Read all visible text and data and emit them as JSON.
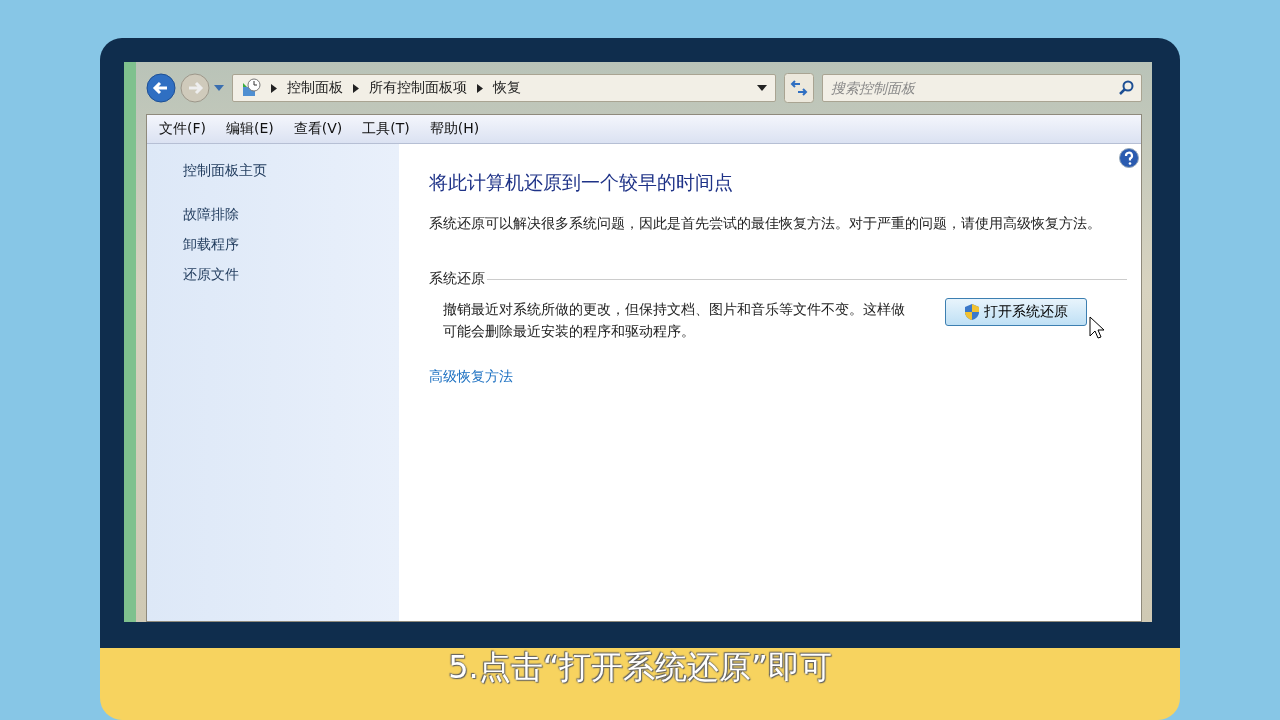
{
  "window": {
    "breadcrumb": [
      "控制面板",
      "所有控制面板项",
      "恢复"
    ],
    "search": {
      "placeholder": "搜索控制面板"
    }
  },
  "menu": [
    "文件(F)",
    "编辑(E)",
    "查看(V)",
    "工具(T)",
    "帮助(H)"
  ],
  "sidebar": {
    "items": [
      {
        "label": "控制面板主页",
        "kind": "home"
      },
      {
        "label": "故障排除",
        "kind": "link"
      },
      {
        "label": "卸载程序",
        "kind": "link"
      },
      {
        "label": "还原文件",
        "kind": "link"
      }
    ]
  },
  "content": {
    "title": "将此计算机还原到一个较早的时间点",
    "intro": "系统还原可以解决很多系统问题，因此是首先尝试的最佳恢复方法。对于严重的问题，请使用高级恢复方法。",
    "section": {
      "heading": "系统还原",
      "text": "撤销最近对系统所做的更改，但保持文档、图片和音乐等文件不变。这样做可能会删除最近安装的程序和驱动程序。",
      "button": "打开系统还原"
    },
    "link": "高级恢复方法"
  },
  "caption": "5.点击“打开系统还原”即可"
}
